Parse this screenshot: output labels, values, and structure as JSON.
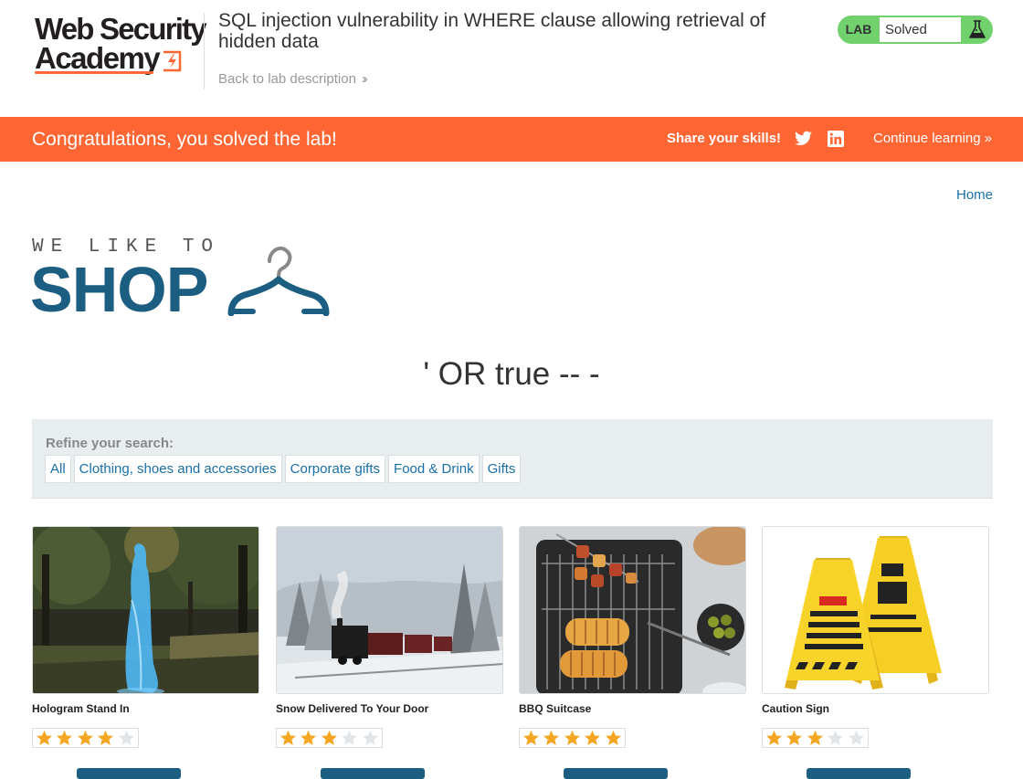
{
  "header": {
    "logo_line1": "Web Security",
    "logo_line2": "Academy",
    "lab_title": "SQL injection vulnerability in WHERE clause allowing retrieval of hidden data",
    "back_link": "Back to lab description",
    "lab_badge": "LAB",
    "lab_status": "Solved"
  },
  "banner": {
    "message": "Congratulations, you solved the lab!",
    "share": "Share your skills!",
    "continue": "Continue learning",
    "color": "#ff6633"
  },
  "nav": {
    "home": "Home"
  },
  "shop_logo": {
    "tagline": "WE LIKE TO",
    "word": "SHOP"
  },
  "search_term": "' OR true -- -",
  "filters": {
    "label": "Refine your search:",
    "categories": [
      "All",
      "Clothing, shoes and accessories",
      "Corporate gifts",
      "Food & Drink",
      "Gifts"
    ]
  },
  "products": [
    {
      "name": "Hologram Stand In",
      "rating": 4,
      "image": "hologram-woman-in-park"
    },
    {
      "name": "Snow Delivered To Your Door",
      "rating": 3,
      "image": "steam-train-in-snow"
    },
    {
      "name": "BBQ Suitcase",
      "rating": 5,
      "image": "bbq-grill-with-skewers"
    },
    {
      "name": "Caution Sign",
      "rating": 3,
      "image": "yellow-caution-signs"
    }
  ],
  "colors": {
    "accent": "#ff6633",
    "link": "#1a6fa7",
    "brand_blue": "#1b5e82",
    "lab_green": "#70d16d",
    "star": "#f5a623"
  }
}
